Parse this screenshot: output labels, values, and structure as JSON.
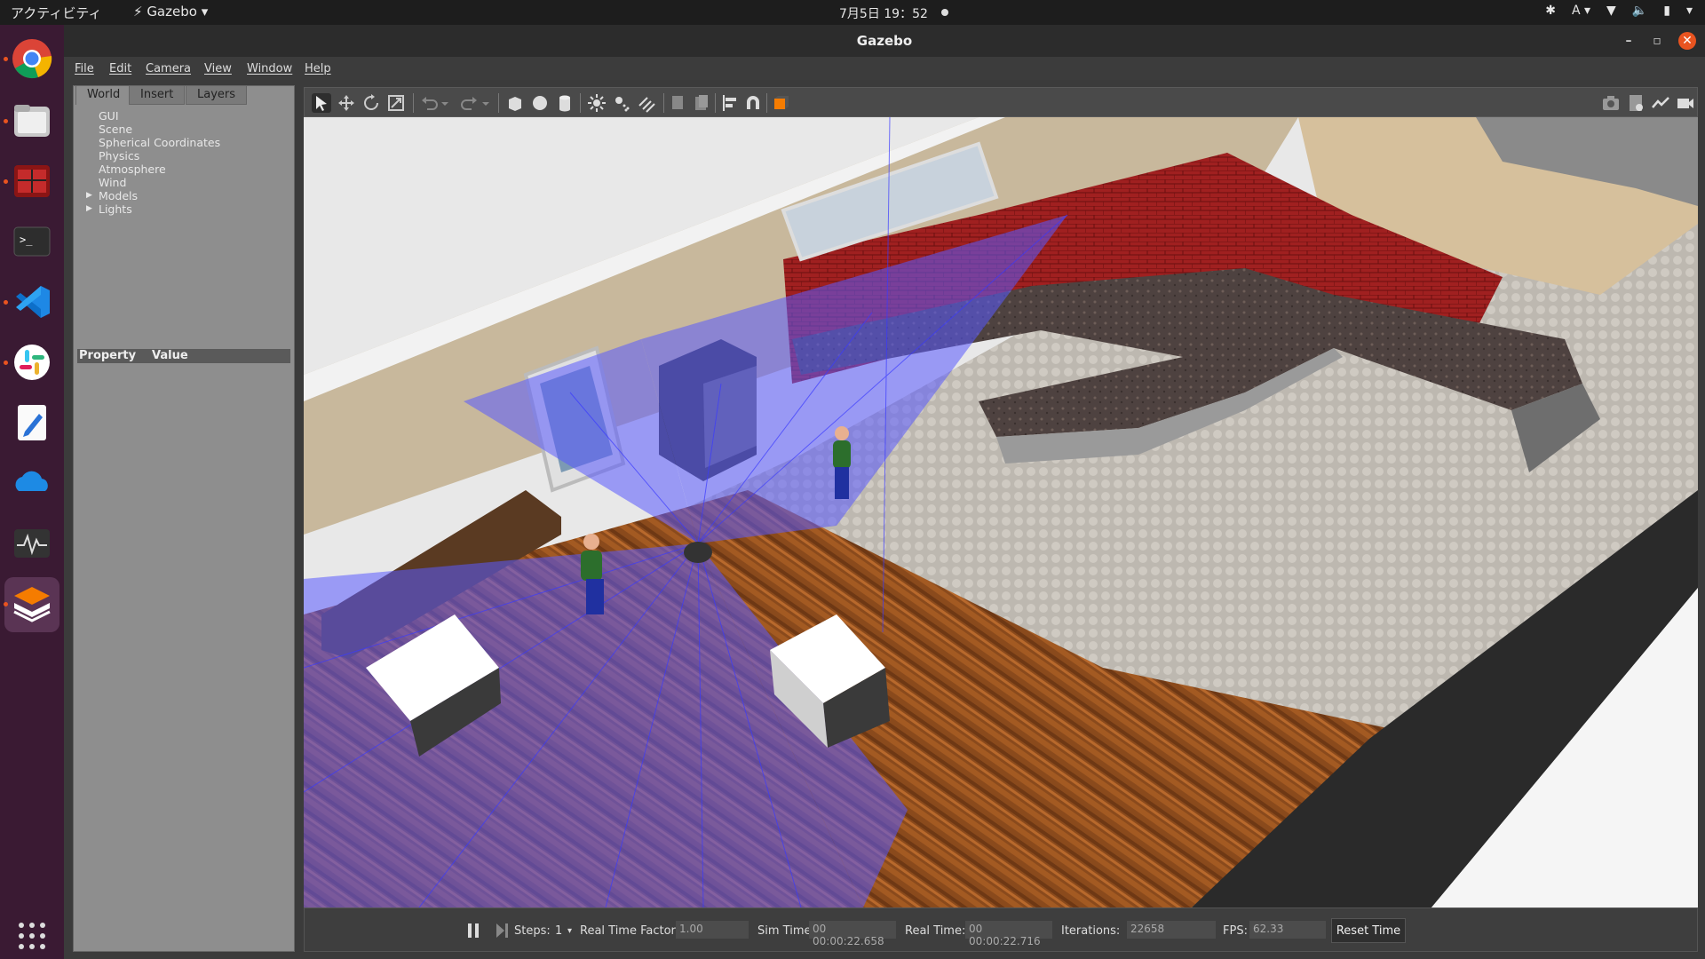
{
  "topbar": {
    "activities": "アクティビティ",
    "app_name": "Gazebo",
    "clock": "7月5日  19：52",
    "input_method": "A"
  },
  "dock": {
    "items": [
      {
        "name": "chrome-icon"
      },
      {
        "name": "files-icon"
      },
      {
        "name": "terminal-red-icon"
      },
      {
        "name": "terminal-icon"
      },
      {
        "name": "vscode-icon"
      },
      {
        "name": "slack-icon"
      },
      {
        "name": "text-editor-icon"
      },
      {
        "name": "onedrive-icon"
      },
      {
        "name": "system-monitor-icon"
      },
      {
        "name": "gazebo-icon"
      }
    ]
  },
  "window": {
    "title": "Gazebo"
  },
  "menu": {
    "file": "File",
    "edit": "Edit",
    "camera": "Camera",
    "view": "View",
    "window": "Window",
    "help": "Help"
  },
  "leftpanel": {
    "tabs": [
      "World",
      "Insert",
      "Layers"
    ],
    "tree": [
      "GUI",
      "Scene",
      "Spherical Coordinates",
      "Physics",
      "Atmosphere",
      "Wind",
      "Models",
      "Lights"
    ],
    "property_header": "Property",
    "value_header": "Value"
  },
  "bottombar": {
    "steps_label": "Steps:",
    "steps_value": "1",
    "rtf_label": "Real Time Factor:",
    "rtf_value": "1.00",
    "sim_time_label": "Sim Time:",
    "sim_time_value": "00 00:00:22.658",
    "real_time_label": "Real Time:",
    "real_time_value": "00 00:00:22.716",
    "iterations_label": "Iterations:",
    "iterations_value": "22658",
    "fps_label": "FPS:",
    "fps_value": "62.33",
    "reset_label": "Reset Time"
  },
  "colors": {
    "accent": "#e95420",
    "laser": "#5a5aff",
    "dock_bg": "#3a1a33"
  }
}
